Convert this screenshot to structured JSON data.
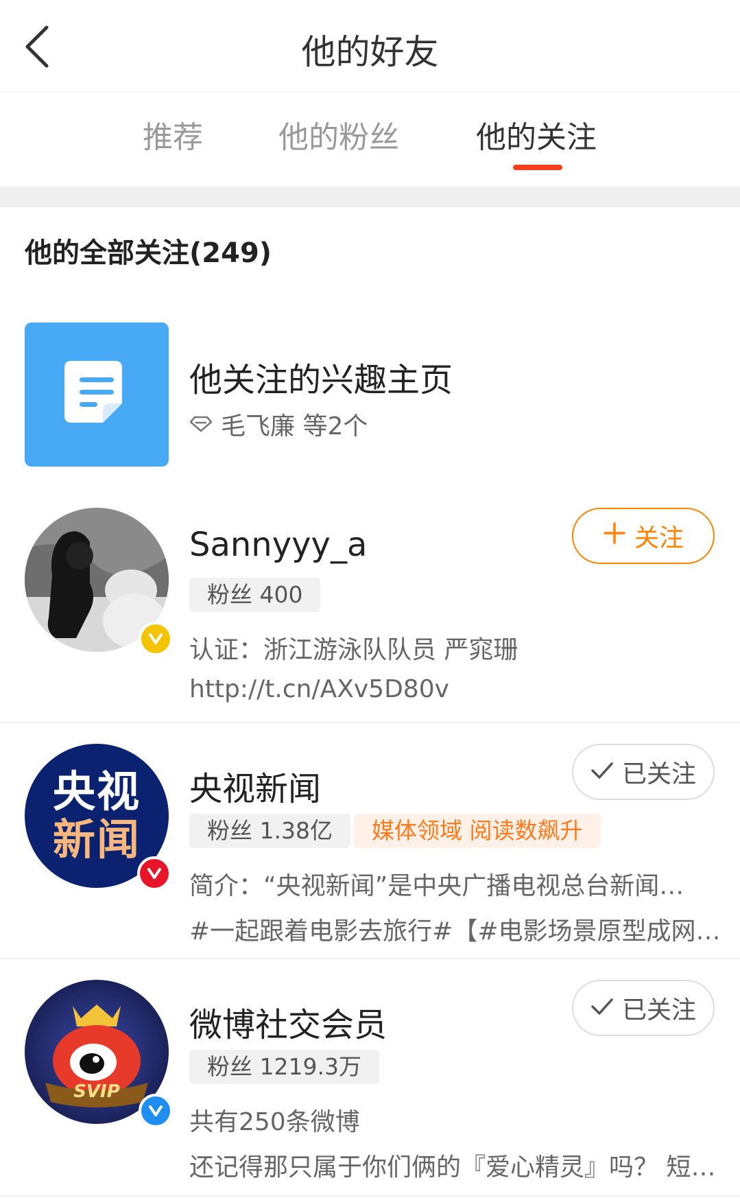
{
  "header": {
    "title": "他的好友"
  },
  "tabs": [
    {
      "label": "推荐"
    },
    {
      "label": "他的粉丝"
    },
    {
      "label": "他的关注"
    }
  ],
  "section": {
    "title": "他的全部关注(249)"
  },
  "interest": {
    "title": "他关注的兴趣主页",
    "subtitle": "毛飞廉 等2个"
  },
  "users": [
    {
      "name": "Sannyyy_a",
      "fans": "粉丝 400",
      "line1": "认证：浙江游泳队队员 严窕珊",
      "line2": "http://t.cn/AXv5D80v",
      "button": "关注",
      "badge_color": "#f5c400"
    },
    {
      "name": "央视新闻",
      "fans": "粉丝 1.38亿",
      "tag": "媒体领域 阅读数飙升",
      "line1": "简介：“央视新闻”是中央广播电视总台新闻…",
      "line2": "#一起跟着电影去旅行#【#电影场景原型成网…",
      "button": "已关注",
      "badge_color": "#e8142a",
      "avatar_text_1": "央视",
      "avatar_text_2": "新闻"
    },
    {
      "name": "微博社交会员",
      "fans": "粉丝 1219.3万",
      "line1": "共有250条微博",
      "line2": "还记得那只属于你们俩的『爱心精灵』吗？ 短…",
      "button": "已关注",
      "badge_color": "#1e8ff0",
      "avatar_text": "SVIP"
    }
  ],
  "colors": {
    "accent": "#ff8200",
    "tab_underline": "#f2401e",
    "interest_bg": "#48aaf5"
  }
}
